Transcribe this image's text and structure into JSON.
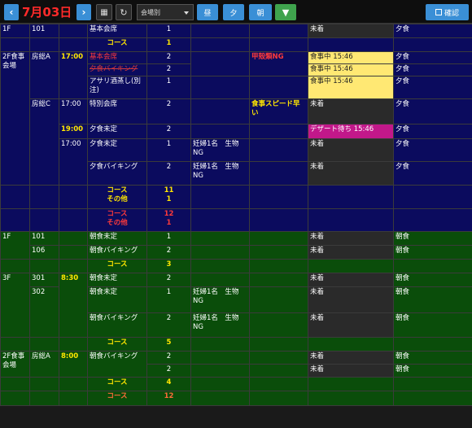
{
  "toolbar": {
    "date": "7月03日",
    "venue_select": "会場別",
    "lunch": "昼",
    "dinner": "夕",
    "breakfast": "朝",
    "confirm": "確認",
    "colors": {
      "accent": "#3a8fd6",
      "green": "#3fa34d",
      "date": "#ff2a2a"
    }
  },
  "dinner": {
    "rows": [
      {
        "floor": "1F",
        "room": "101",
        "time": "",
        "course": "基本会席",
        "qty": "1",
        "note": "",
        "remark": "",
        "status": "未着",
        "meal": "夕食"
      }
    ],
    "sum1": {
      "label": "コース",
      "value": "1"
    },
    "rows2": [
      {
        "floor": "2F食事会場",
        "room": "房総A",
        "time": "17:00",
        "course": "基本会席",
        "course_strike": "夕食バイキング",
        "qty": "2",
        "qty2": "2",
        "note": "",
        "remark": "甲殻類NG",
        "status": "食事中 15:46",
        "status2": "食事中 15:46",
        "meal": "夕食",
        "meal2": "夕食"
      },
      {
        "course": "アサリ酒蒸し(別注)",
        "qty": "1",
        "status": "食事中 15:46",
        "meal": "夕食"
      },
      {
        "room": "房総C",
        "time": "17:00",
        "course": "特別会席",
        "qty": "2",
        "remark": "食事スピード早い",
        "status": "未着",
        "meal": "夕食"
      },
      {
        "time": "19:00",
        "course": "夕食未定",
        "qty": "2",
        "status": "デザート待ち 15:46",
        "meal": "夕食"
      },
      {
        "time": "17:00",
        "course": "夕食未定",
        "qty": "1",
        "note": "妊婦1名　生物NG",
        "status": "未着",
        "meal": "夕食"
      },
      {
        "course": "夕食バイキング",
        "qty": "2",
        "note": "妊婦1名　生物NG",
        "status": "未着",
        "meal": "夕食"
      }
    ],
    "sum2": {
      "label": "コース",
      "value": "11",
      "label2": "その他",
      "value2": "1"
    },
    "sum3": {
      "label": "コース",
      "value": "12",
      "label2": "その他",
      "value2": "1"
    }
  },
  "breakfast": {
    "rows": [
      {
        "floor": "1F",
        "room": "101",
        "course": "朝食未定",
        "qty": "1",
        "status": "未着",
        "meal": "朝食"
      },
      {
        "room": "106",
        "course": "朝食バイキング",
        "qty": "2",
        "status": "未着",
        "meal": "朝食"
      }
    ],
    "sum1": {
      "label": "コース",
      "value": "3"
    },
    "rows3f": [
      {
        "floor": "3F",
        "room": "301",
        "time": "8:30",
        "course": "朝食未定",
        "qty": "2",
        "status": "未着",
        "meal": "朝食"
      },
      {
        "room": "302",
        "course": "朝食未定",
        "qty": "1",
        "note": "妊婦1名　生物NG",
        "status": "未着",
        "meal": "朝食"
      },
      {
        "course": "朝食バイキング",
        "qty": "2",
        "note": "妊婦1名　生物NG",
        "status": "未着",
        "meal": "朝食"
      }
    ],
    "sum2": {
      "label": "コース",
      "value": "5"
    },
    "rows2f": [
      {
        "floor": "2F食事会場",
        "room": "房総A",
        "time": "8:00",
        "course": "朝食バイキング",
        "qty": "2",
        "qty2": "2",
        "status": "未着",
        "status2": "未着",
        "meal": "朝食",
        "meal2": "朝食"
      }
    ],
    "sum3": {
      "label": "コース",
      "value": "4"
    },
    "sum4": {
      "label": "コース",
      "value": "12"
    }
  }
}
